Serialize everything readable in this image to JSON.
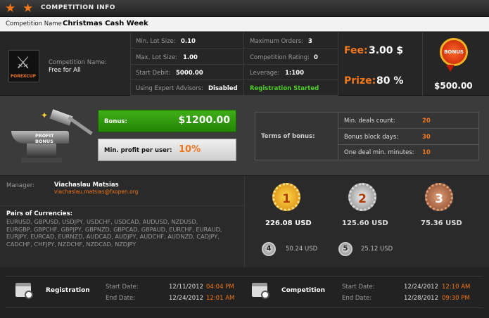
{
  "window": {
    "title": "COMPETITION INFO"
  },
  "competition": {
    "name_label": "Competition Name",
    "name_value": "Christmas Cash Week"
  },
  "info": {
    "logo_text": "FOREXCUP",
    "comp_name_label": "Competition Name:",
    "comp_name_value": "Free for All",
    "min_lot_label": "Min. Lot Size:",
    "min_lot_value": "0.10",
    "max_lot_label": "Max. Lot Size:",
    "max_lot_value": "1.00",
    "start_debit_label": "Start Debit:",
    "start_debit_value": "5000.00",
    "ea_label": "Using Expert Advisors:",
    "ea_value": "Disabled",
    "max_orders_label": "Maximum Orders:",
    "max_orders_value": "3",
    "rating_label": "Competition Rating:",
    "rating_value": "0",
    "leverage_label": "Leverage:",
    "leverage_value": "1:100",
    "status": "Registration Started",
    "fee_label": "Fee:",
    "fee_value": "3.00 $",
    "prize_label": "Prize:",
    "prize_value": "80 %",
    "bonus_badge": "BONUS",
    "bonus_total": "$500.00"
  },
  "bonus": {
    "anvil_text": "PROFIT BONUS",
    "bonus_label": "Bonus:",
    "bonus_value": "$1200.00",
    "min_profit_label": "Min. profit per user:",
    "min_profit_value": "10%",
    "terms_label": "Terms of bonus:",
    "terms": [
      {
        "label": "Min. deals count:",
        "value": "20"
      },
      {
        "label": "Bonus block days:",
        "value": "30"
      },
      {
        "label": "One deal min. minutes:",
        "value": "10"
      }
    ]
  },
  "manager": {
    "label": "Manager:",
    "name": "Viachaslau Matsias",
    "email": "viachaslau.matsias@fxopen.org"
  },
  "pairs": {
    "label": "Pairs of Currencies:",
    "lines": [
      "EURUSD, GBPUSD, USDJPY, USDCHF, USDCAD, AUDUSD, NZDUSD,",
      "EURGBP, GBPCHF, GBPJPY, GBPNZD, GBPCAD, GBPAUD, EURCHF, EURAUD,",
      "EURJPY, EURCAD, EURNZD, AUDCAD, AUDJPY, AUDCHF, AUDNZD, CADJPY,",
      "CADCHF, CHFJPY, NZDCHF, NZDCAD, NZDJPY"
    ]
  },
  "prizes": {
    "first": {
      "place": "1st",
      "amount": "226.08 USD",
      "color": "#e8a51a"
    },
    "second": {
      "place": "2nd",
      "amount": "125.60 USD",
      "color": "#b5b5b5"
    },
    "third": {
      "place": "3rd",
      "amount": "75.36 USD",
      "color": "#b26a43"
    },
    "fourth": {
      "place": "4",
      "amount": "50.24 USD"
    },
    "fifth": {
      "place": "5",
      "amount": "25.12 USD"
    }
  },
  "dates": {
    "registration": {
      "title": "Registration",
      "start_label": "Start Date:",
      "start_date": "12/11/2012",
      "start_time": "04:04 PM",
      "end_label": "End Date:",
      "end_date": "12/24/2012",
      "end_time": "12:01 AM"
    },
    "competition": {
      "title": "Competition",
      "start_label": "Start Date:",
      "start_date": "12/24/2012",
      "start_time": "12:10 AM",
      "end_label": "End Date:",
      "end_date": "12/28/2012",
      "end_time": "09:30 PM"
    }
  },
  "colors": {
    "accent": "#f0761c",
    "status_green": "#4fcf2a",
    "bonus_green": "#3fae16"
  }
}
